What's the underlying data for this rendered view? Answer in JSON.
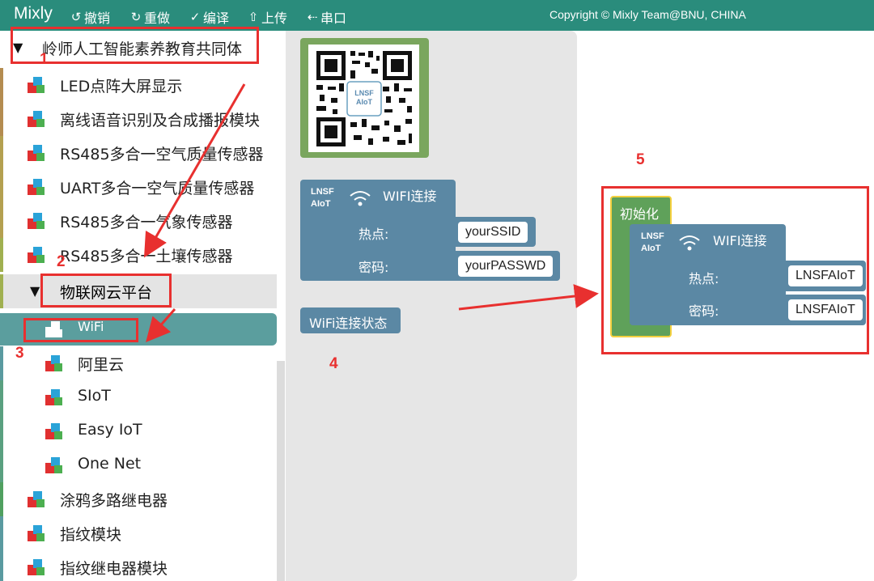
{
  "header": {
    "brand": "Mixly",
    "menu": [
      {
        "label": "撤销",
        "icon": "undo-icon",
        "glyph": "↺"
      },
      {
        "label": "重做",
        "icon": "redo-icon",
        "glyph": "↻"
      },
      {
        "label": "编译",
        "icon": "check-icon",
        "glyph": "✓"
      },
      {
        "label": "上传",
        "icon": "upload-icon",
        "glyph": "⇧"
      },
      {
        "label": "串口",
        "icon": "usb-icon",
        "glyph": "⇠"
      }
    ],
    "copyright": "Copyright © Mixly Team@BNU, CHINA"
  },
  "sidebar": {
    "root_category": "岭师人工智能素养教育共同体",
    "items": [
      {
        "label": "LED点阵大屏显示"
      },
      {
        "label": "离线语音识别及合成播报模块"
      },
      {
        "label": "RS485多合一空气质量传感器"
      },
      {
        "label": "UART多合一空气质量传感器"
      },
      {
        "label": "RS485多合一气象传感器"
      },
      {
        "label": "RS485多合一土壤传感器"
      }
    ],
    "group": "物联网云平台",
    "group_items": [
      {
        "label": "WiFi",
        "selected": true
      },
      {
        "label": "阿里云"
      },
      {
        "label": "SIoT"
      },
      {
        "label": "Easy IoT"
      },
      {
        "label": "One Net"
      }
    ],
    "tail_items": [
      {
        "label": "涂鸦多路继电器"
      },
      {
        "label": "指纹模块"
      },
      {
        "label": "指纹继电器模块"
      }
    ]
  },
  "flyout": {
    "qr_logo": "LNSF AIoT",
    "wifi_block": {
      "logo_line1": "LNSF",
      "logo_line2": "AIoT",
      "title": "WIFI连接",
      "hotspot_label": "热点:",
      "password_label": "密码:",
      "ssid_value": "yourSSID",
      "password_value": "yourPASSWD"
    },
    "status_block": "WiFi连接状态"
  },
  "workspace": {
    "init_label": "初始化",
    "wifi_block": {
      "logo_line1": "LNSF",
      "logo_line2": "AIoT",
      "title": "WIFI连接",
      "hotspot_label": "热点:",
      "password_label": "密码:",
      "ssid_value": "LNSFAIoT",
      "password_value": "LNSFAIoT"
    }
  },
  "annotations": [
    "1",
    "2",
    "3",
    "4",
    "5"
  ],
  "colors": {
    "topbar": "#2a8c7c",
    "block_blue": "#5b88a4",
    "init_green": "#5fa15a",
    "qr_green": "#7aa65e",
    "selected": "#5b9e9e",
    "annotation_red": "#e8302f"
  }
}
